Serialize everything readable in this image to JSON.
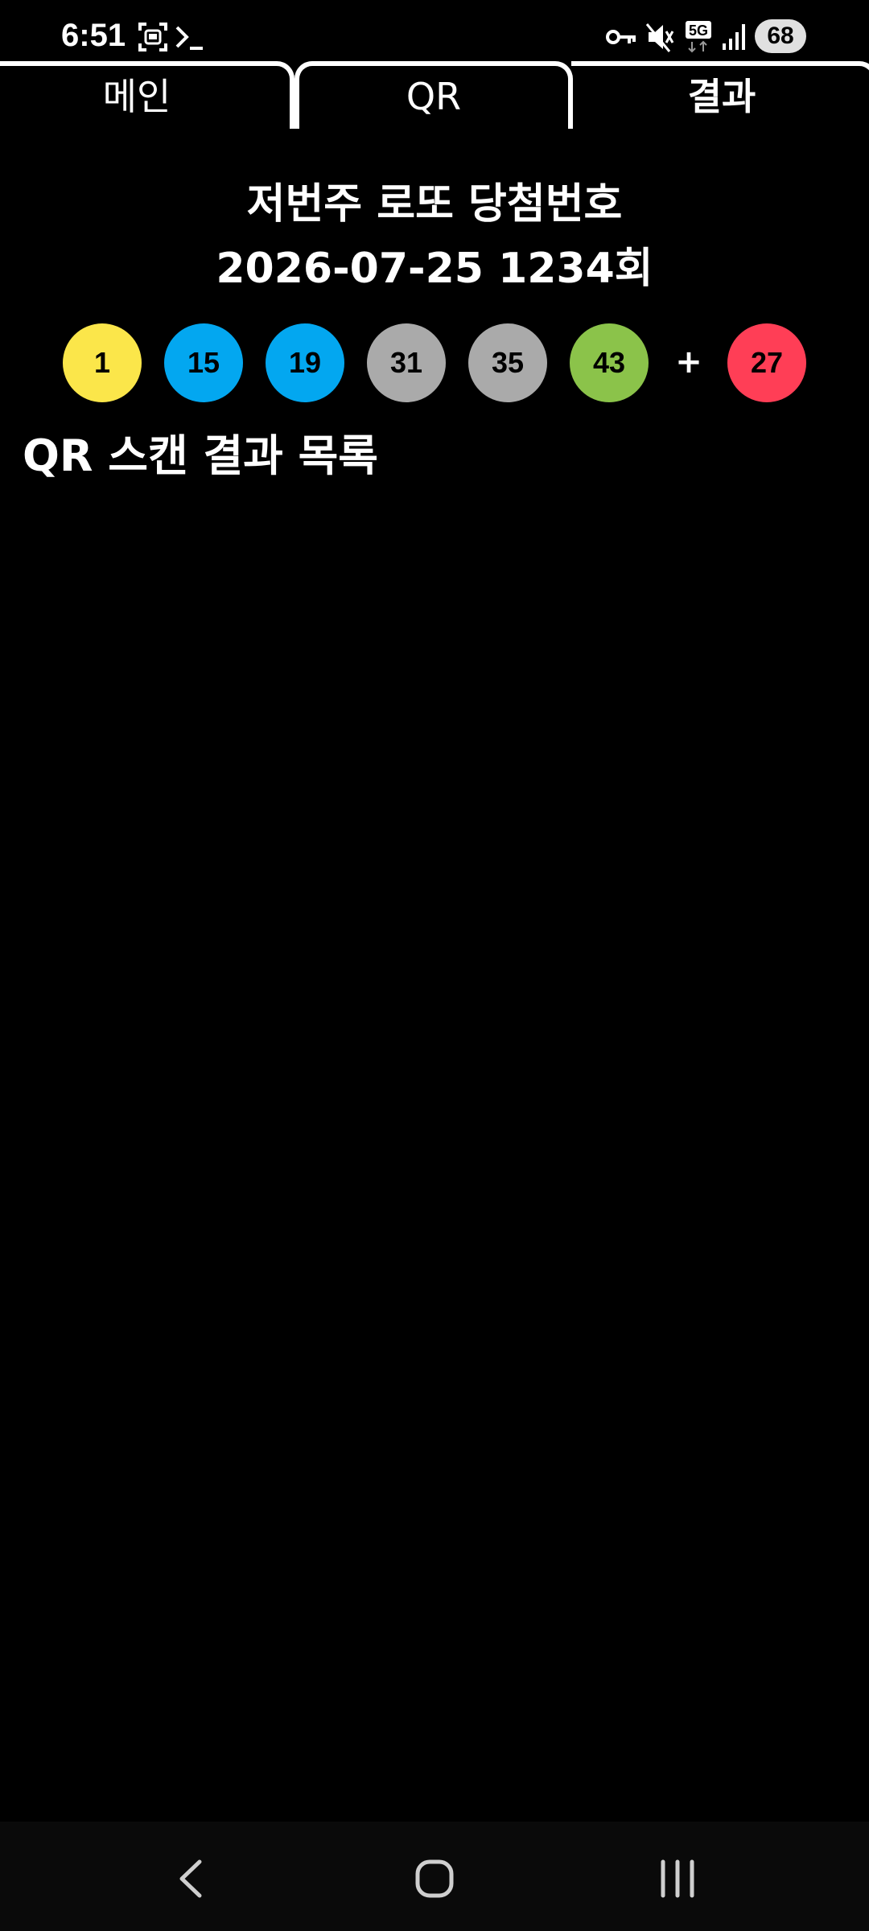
{
  "status_bar": {
    "time": "6:51",
    "battery": "68",
    "icons": [
      "screenshot-icon",
      "terminal-icon",
      "vpn-key-icon",
      "mute-icon",
      "5g-icon",
      "signal-icon"
    ]
  },
  "tabs": [
    {
      "label": "메인",
      "selected": false
    },
    {
      "label": "QR",
      "selected": false
    },
    {
      "label": "결과",
      "selected": true
    }
  ],
  "draw": {
    "title": "저번주 로또 당첨번호",
    "date_round": "2026-07-25 1234회",
    "numbers": [
      {
        "value": "1",
        "color": "#fbe64a"
      },
      {
        "value": "15",
        "color": "#03a7f0"
      },
      {
        "value": "19",
        "color": "#03a7f0"
      },
      {
        "value": "31",
        "color": "#aaaaaa"
      },
      {
        "value": "35",
        "color": "#aaaaaa"
      },
      {
        "value": "43",
        "color": "#8bc34a"
      }
    ],
    "plus": "+",
    "bonus": {
      "value": "27",
      "color": "#ff3e56"
    }
  },
  "list": {
    "title": "QR 스캔 결과 목록",
    "items": []
  },
  "nav": {
    "icons": [
      "back-icon",
      "home-icon",
      "recents-icon"
    ]
  }
}
